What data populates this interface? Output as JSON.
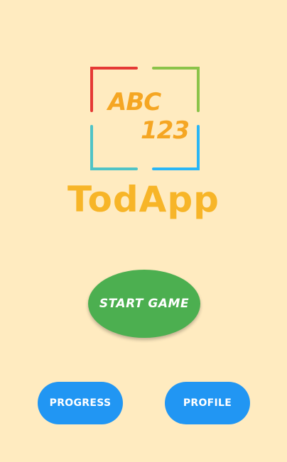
{
  "logo": {
    "line1": "ABC",
    "line2": "123",
    "corner_colors": {
      "top_left": "#E53935",
      "top_right": "#8BC34A",
      "bottom_left": "#4FC3C6",
      "bottom_right": "#29B6F6"
    },
    "text_color": "#F5A623"
  },
  "app_name": "TodApp",
  "buttons": {
    "start_game": "START GAME",
    "progress": "PROGRESS",
    "profile": "PROFILE"
  },
  "colors": {
    "background": "#FFEBC0",
    "start_button": "#4CAF50",
    "secondary_buttons": "#2196F3"
  }
}
